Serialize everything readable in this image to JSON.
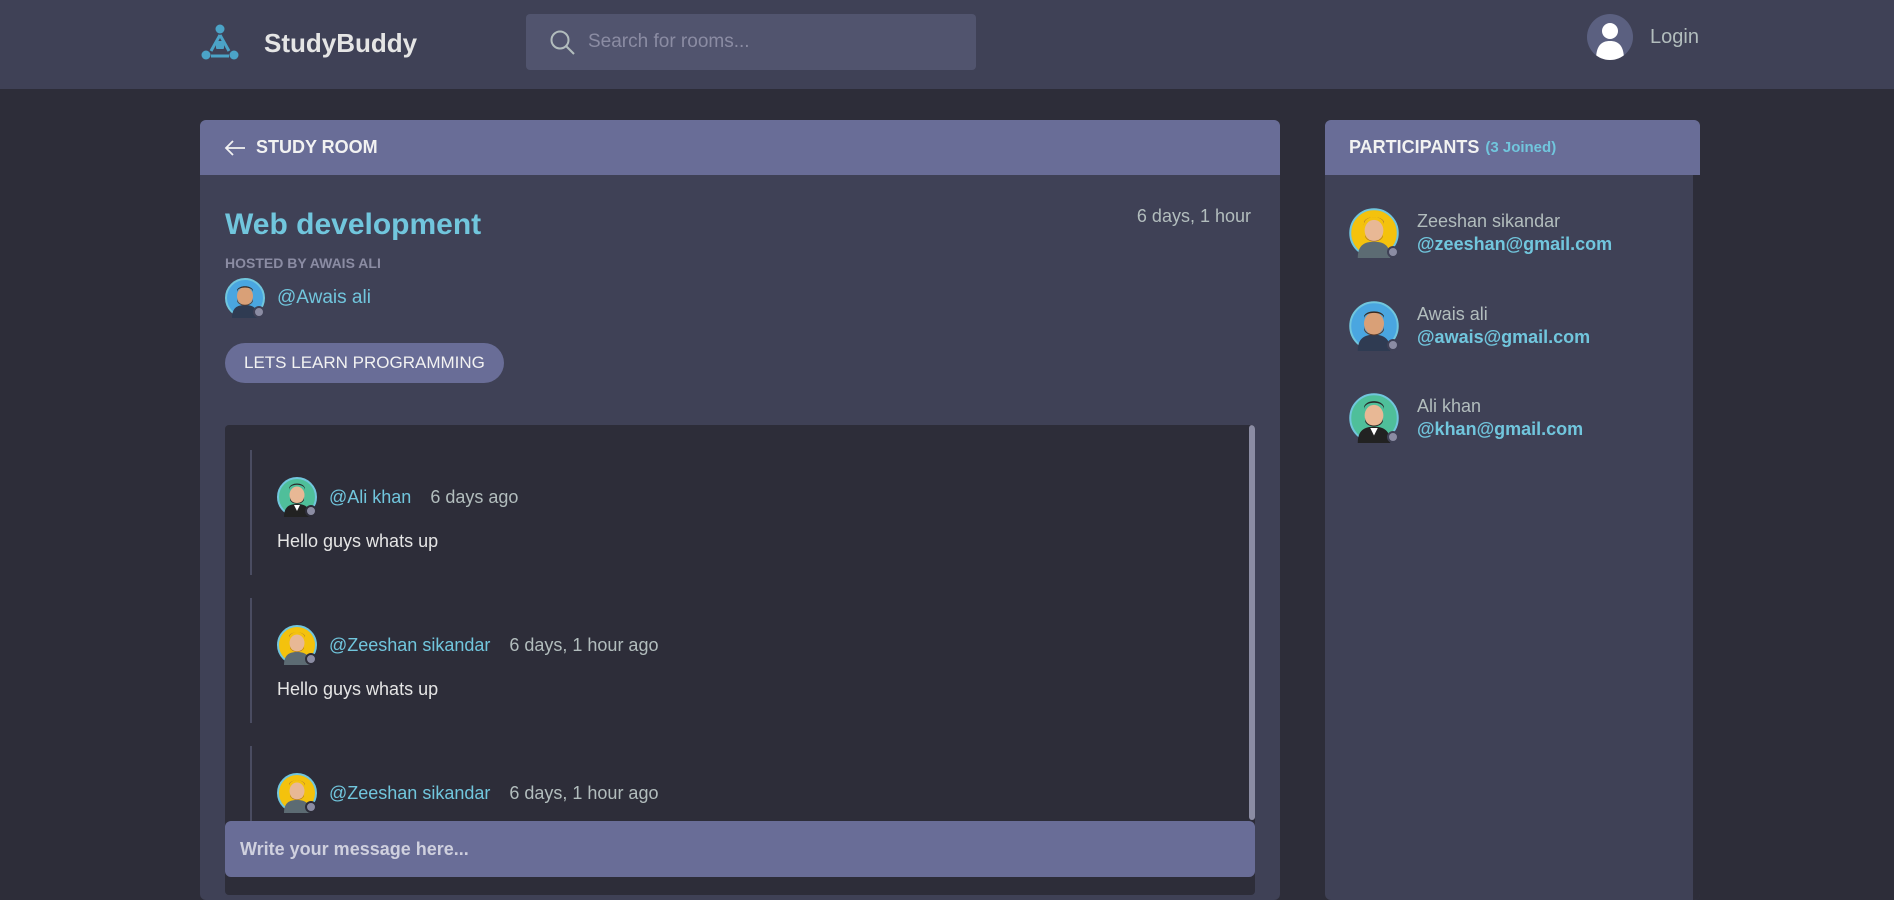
{
  "app": {
    "name": "StudyBuddy"
  },
  "search": {
    "placeholder": "Search for rooms..."
  },
  "auth": {
    "login_label": "Login"
  },
  "room": {
    "header_label": "STUDY ROOM",
    "title": "Web development",
    "time": "6 days, 1 hour",
    "hosted_by": "HOSTED BY AWAIS ALI",
    "host_handle": "@Awais ali",
    "topic": "LETS LEARN PROGRAMMING"
  },
  "messages": [
    {
      "author": "@Ali khan",
      "date": "6 days ago",
      "body": "Hello guys whats up"
    },
    {
      "author": "@Zeeshan sikandar",
      "date": "6 days, 1 hour ago",
      "body": "Hello guys whats up"
    },
    {
      "author": "@Zeeshan sikandar",
      "date": "6 days, 1 hour ago",
      "body": ""
    }
  ],
  "composer": {
    "placeholder": "Write your message here..."
  },
  "participants": {
    "title": "PARTICIPANTS",
    "count": "(3 Joined)",
    "items": [
      {
        "name": "Zeeshan sikandar",
        "email": "@zeeshan@gmail.com"
      },
      {
        "name": "Awais ali",
        "email": "@awais@gmail.com"
      },
      {
        "name": "Ali khan",
        "email": "@khan@gmail.com"
      }
    ]
  },
  "colors": {
    "background": "#2d2d39",
    "panel": "#3f4156",
    "header_bar": "#696d97",
    "accent": "#71c6dd",
    "muted_text": "#b2bdbd"
  },
  "icons": [
    "logo-icon",
    "search-icon",
    "user-icon",
    "back-arrow-icon",
    "online-status-icon"
  ]
}
